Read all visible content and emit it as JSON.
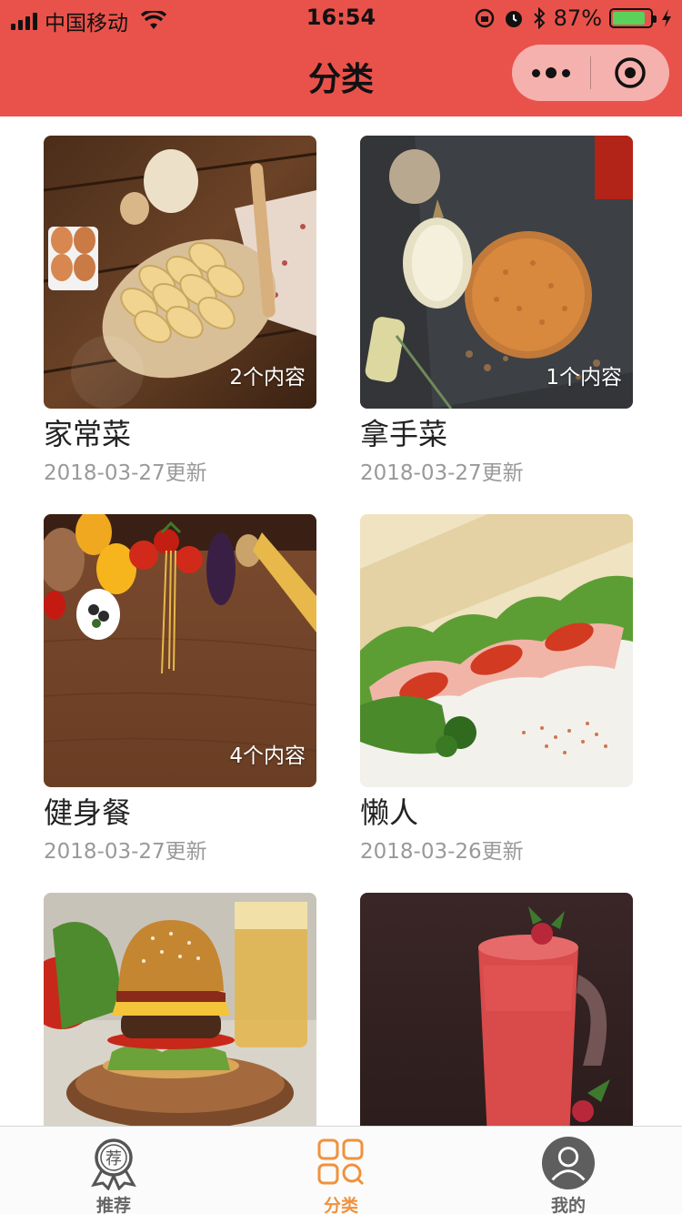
{
  "status": {
    "carrier": "中国移动",
    "time": "16:54",
    "battery": "87%",
    "battery_level": 0.87
  },
  "nav": {
    "title": "分类"
  },
  "cards": [
    {
      "count": "2个内容",
      "title": "家常菜",
      "date": "2018-03-27更新"
    },
    {
      "count": "1个内容",
      "title": "拿手菜",
      "date": "2018-03-27更新"
    },
    {
      "count": "4个内容",
      "title": "健身餐",
      "date": "2018-03-27更新"
    },
    {
      "count": "",
      "title": "懒人",
      "date": "2018-03-26更新"
    },
    {
      "count": "",
      "title": "",
      "date": ""
    },
    {
      "count": "",
      "title": "",
      "date": ""
    }
  ],
  "tabbar": {
    "items": [
      {
        "label": "推荐",
        "icon": "badge-icon",
        "glyph": "荐"
      },
      {
        "label": "分类",
        "icon": "grid-icon"
      },
      {
        "label": "我的",
        "icon": "profile-icon"
      }
    ],
    "active_color": "#f0923d"
  },
  "colors": {
    "nav_bg": "#e9524b"
  }
}
